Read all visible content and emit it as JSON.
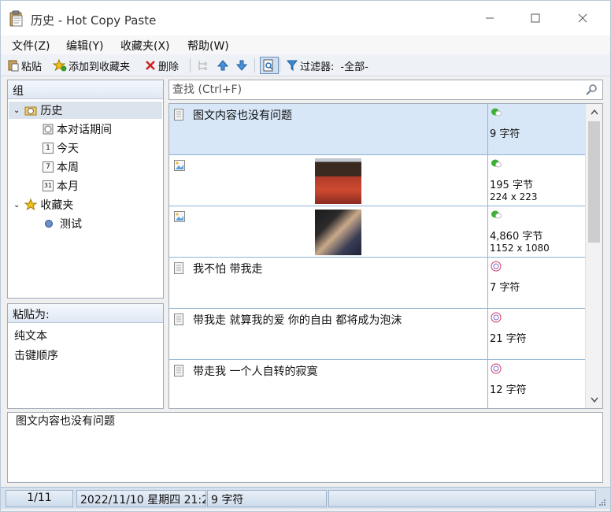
{
  "window": {
    "title": "历史 - Hot Copy Paste"
  },
  "menu": {
    "file": "文件(Z)",
    "edit": "编辑(Y)",
    "favorites": "收藏夹(X)",
    "help": "帮助(W)"
  },
  "toolbar": {
    "paste": "粘贴",
    "add_fav": "添加到收藏夹",
    "delete": "删除",
    "filter_label": "过滤器:",
    "filter_value": "-全部-"
  },
  "groups": {
    "header": "组",
    "history": "历史",
    "session": "本对话期间",
    "today": "今天",
    "week": "本周",
    "month": "本月",
    "favorites": "收藏夹",
    "test": "测试",
    "day_num_today": "1",
    "day_num_week": "7",
    "day_num_month": "31"
  },
  "paste_as": {
    "header": "粘贴为:",
    "options": [
      "纯文本",
      "击键顺序"
    ]
  },
  "search": {
    "placeholder": "查找 (Ctrl+F)"
  },
  "items": [
    {
      "type": "text",
      "text": "图文内容也没有问题",
      "size": "9 字符",
      "source": "wechat"
    },
    {
      "type": "image",
      "text": "",
      "size": "195 字节",
      "dims": "224 x 223",
      "source": "wechat"
    },
    {
      "type": "image",
      "text": "",
      "size": "4,860 字节",
      "dims": "1152 x 1080",
      "source": "wechat"
    },
    {
      "type": "text",
      "text": "我不怕 带我走",
      "size": "7 字符",
      "source": "music"
    },
    {
      "type": "text",
      "text": "带我走 就算我的爱 你的自由 都将成为泡沫",
      "size": "21 字符",
      "source": "music"
    },
    {
      "type": "text",
      "text": "带走我 一个人自转的寂寞",
      "size": "12 字符",
      "source": "music"
    }
  ],
  "preview": {
    "text": "图文内容也没有问题"
  },
  "status": {
    "position": "1/11",
    "datetime": "2022/11/10 星期四 21:2",
    "size": "9 字符"
  },
  "colors": {
    "accent": "#d8e7f7",
    "row_border": "#8fb3d4",
    "status_bar": "#d6e1ee"
  }
}
